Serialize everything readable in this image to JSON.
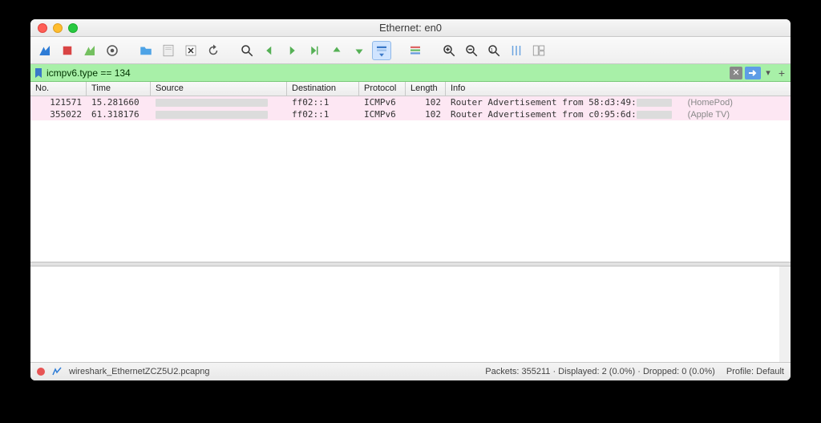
{
  "window": {
    "title": "Ethernet: en0"
  },
  "toolbar": {
    "icons": [
      "shark-fin",
      "stop",
      "restart",
      "options",
      "open",
      "save",
      "close",
      "reload",
      "find",
      "go-back",
      "go-forward",
      "go-to",
      "jump-prev",
      "jump-next",
      "auto-scroll",
      "colorize",
      "zoom-in",
      "zoom-out",
      "zoom-reset",
      "resize-cols",
      "layout"
    ]
  },
  "filter": {
    "value": "icmpv6.type == 134",
    "clear_label": "✕",
    "plus_label": "+"
  },
  "columns": {
    "no": "No.",
    "time": "Time",
    "source": "Source",
    "destination": "Destination",
    "protocol": "Protocol",
    "length": "Length",
    "info": "Info"
  },
  "packets": [
    {
      "no": "121571",
      "time": "15.281660",
      "destination": "ff02::1",
      "protocol": "ICMPv6",
      "length": "102",
      "info_prefix": "Router Advertisement from 58:d3:49:",
      "annotation": "(HomePod)"
    },
    {
      "no": "355022",
      "time": "61.318176",
      "destination": "ff02::1",
      "protocol": "ICMPv6",
      "length": "102",
      "info_prefix": "Router Advertisement from c0:95:6d:",
      "annotation": "(Apple TV)"
    }
  ],
  "status": {
    "file": "wireshark_EthernetZCZ5U2.pcapng",
    "packets": "Packets: 355211 · Displayed: 2 (0.0%) · Dropped: 0 (0.0%)",
    "profile": "Profile: Default"
  }
}
